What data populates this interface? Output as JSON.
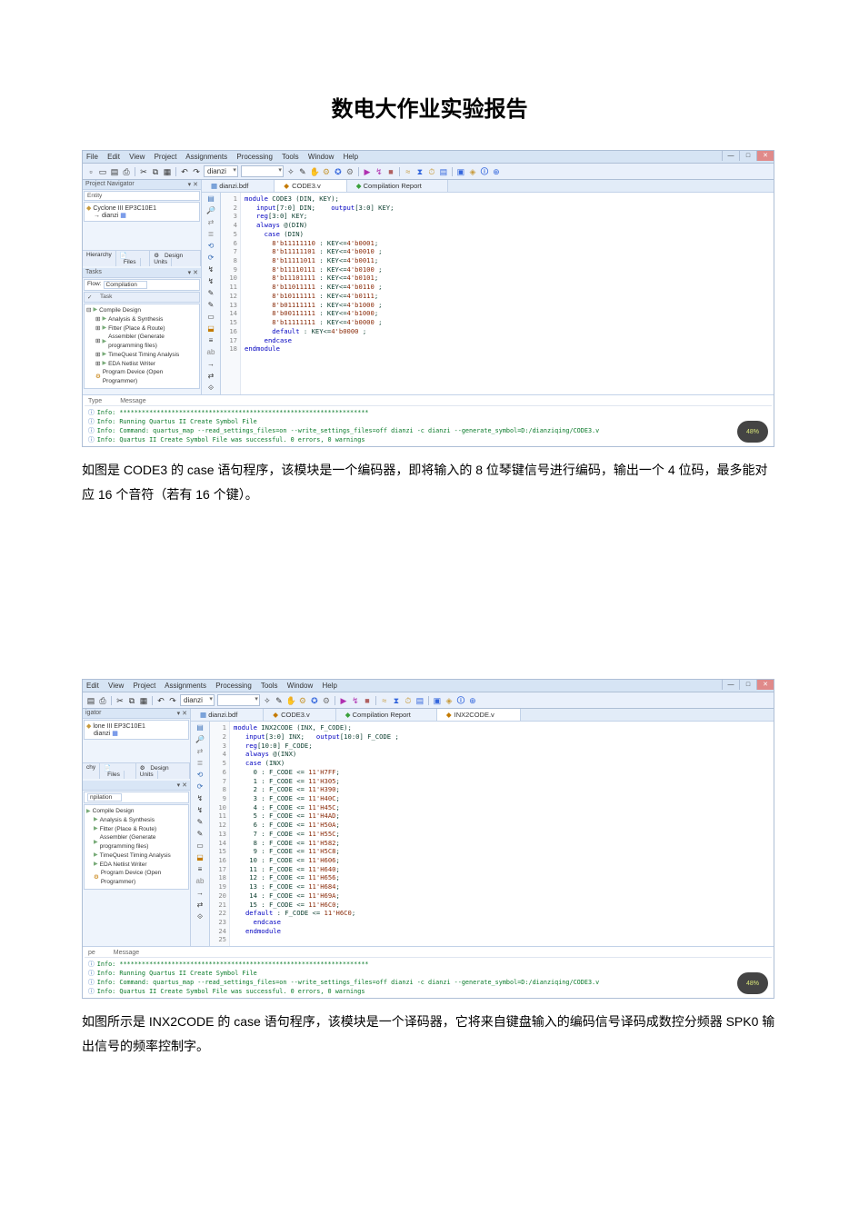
{
  "doc": {
    "title": "数电大作业实验报告",
    "para1": "如图是 CODE3 的 case 语句程序，该模块是一个编码器，即将输入的 8 位琴键信号进行编码，输出一个 4 位码，最多能对应 16 个音符（若有 16 个键）。",
    "para2": "如图所示是 INX2CODE 的 case 语句程序，该模块是一个译码器，它将来自键盘输入的编码信号译码成数控分频器 SPK0 输出信号的频率控制字。"
  },
  "shot1": {
    "menu": [
      "File",
      "Edit",
      "View",
      "Project",
      "Assignments",
      "Processing",
      "Tools",
      "Window",
      "Help"
    ],
    "toolbar_combo": "dianzi",
    "nav_title": "Project Navigator",
    "device": "Cyclone III  EP3C10E1",
    "top_entity": "dianzi",
    "hier_tabs": [
      "Hierarchy",
      "Files",
      "Design Units"
    ],
    "tasks_header": "Compilation",
    "tasks": [
      "Compile Design",
      "Analysis & Synthesis",
      "Fitter (Place & Route)",
      "Assembler (Generate programming files)",
      "TimeQuest Timing Analysis",
      "EDA Netlist Writer",
      "Program Device (Open Programmer)"
    ],
    "tabs": {
      "t1": "dianzi.bdf",
      "t2": "CODE3.v",
      "t3": "Compilation Report"
    },
    "code_lines": [
      "module CODE3 (DIN, KEY);",
      "   input[7:0] DIN;    output[3:0] KEY;",
      "   reg[3:0] KEY;",
      "   always @(DIN)",
      "     case (DIN)",
      "       8'b11111110 : KEY<=4'b0001;",
      "       8'b11111101 : KEY<=4'b0010 ;",
      "       8'b11111011 : KEY<=4'b0011;",
      "       8'b11110111 : KEY<=4'b0100 ;",
      "       8'b11101111 : KEY<=4'b0101;",
      "       8'b11011111 : KEY<=4'b0110 ;",
      "       8'b10111111 : KEY<=4'b0111;",
      "       8'b01111111 : KEY<=4'b1000 ;",
      "       8'b00111111 : KEY<=4'b1000;",
      "       8'b11111111 : KEY<=4'b0000 ;",
      "       default : KEY<=4'b0000 ;",
      "     endcase",
      "endmodule"
    ],
    "msg_head": [
      "Type",
      "Message"
    ],
    "messages": [
      "Info: *******************************************************************",
      "Info: Running Quartus II Create Symbol File",
      "Info: Command: quartus_map --read_settings_files=on --write_settings_files=off dianzi -c dianzi --generate_symbol=D:/dianziqing/CODE3.v",
      "Info: Quartus II Create Symbol File was successful. 0 errors, 0 warnings"
    ],
    "badge": "48%"
  },
  "shot2": {
    "menu": [
      "Edit",
      "View",
      "Project",
      "Assignments",
      "Processing",
      "Tools",
      "Window",
      "Help"
    ],
    "toolbar_combo": "dianzi",
    "nav_title": "igator",
    "device": "lone III  EP3C10E1",
    "top_entity": "dianzi",
    "hier_tabs": [
      "chy",
      "Files",
      "Design Units"
    ],
    "tasks_header": "npilation",
    "tasks": [
      "Compile Design",
      "Analysis & Synthesis",
      "Fitter (Place & Route)",
      "Assembler (Generate programming files)",
      "TimeQuest Timing Analysis",
      "EDA Netlist Writer",
      "Program Device (Open Programmer)"
    ],
    "tabs": {
      "t1": "dianzi.bdf",
      "t2": "CODE3.v",
      "t3": "Compilation Report",
      "t4": "INX2CODE.v"
    },
    "code_lines": [
      "module INX2CODE (INX, F_CODE);",
      "   input[3:0] INX;   output[10:0] F_CODE ;",
      "   reg[10:0] F_CODE;",
      "   always @(INX)",
      "   case (INX)",
      "     0 : F_CODE <= 11'H7FF;",
      "     1 : F_CODE <= 11'H305;",
      "     2 : F_CODE <= 11'H390;",
      "     3 : F_CODE <= 11'H40C;",
      "     4 : F_CODE <= 11'H45C;",
      "     5 : F_CODE <= 11'H4AD;",
      "     6 : F_CODE <= 11'H50A;",
      "     7 : F_CODE <= 11'H55C;",
      "     8 : F_CODE <= 11'H582;",
      "     9 : F_CODE <= 11'H5C8;",
      "    10 : F_CODE <= 11'H606;",
      "    11 : F_CODE <= 11'H640;",
      "    12 : F_CODE <= 11'H656;",
      "    13 : F_CODE <= 11'H684;",
      "    14 : F_CODE <= 11'H69A;",
      "    15 : F_CODE <= 11'H6C0;",
      "   default : F_CODE <= 11'H6C0;",
      "     endcase",
      "   endmodule",
      ""
    ],
    "msg_head": [
      "pe",
      "Message"
    ],
    "messages": [
      "Info: *******************************************************************",
      "Info: Running Quartus II Create Symbol File",
      "Info: Command: quartus_map --read_settings_files=on --write_settings_files=off dianzi -c dianzi --generate_symbol=D:/dianziqing/CODE3.v",
      "Info: Quartus II Create Symbol File was successful. 0 errors, 0 warnings"
    ],
    "badge": "48%"
  },
  "icons": {
    "new": "▫",
    "open": "▭",
    "save": "▤",
    "print": "⎙",
    "cut": "✂",
    "copy": "⧉",
    "paste": "▦",
    "undo": "↶",
    "redo": "↷",
    "wand": "✧",
    "pen": "✎",
    "zoom": "⌕",
    "a": "A",
    "abc": "ab",
    "comp": "▶",
    "stop": "■",
    "chip": "▣",
    "gear": "⚙",
    "blue": "◆",
    "help": "?",
    "bug": "✪",
    "abc2": "✱",
    "c1": "⬒",
    "c2": "◧",
    "c3": "◨",
    "c4": "▤",
    "c5": "⧈",
    "c6": "≡",
    "c7": "→",
    "c8": "⇄"
  }
}
